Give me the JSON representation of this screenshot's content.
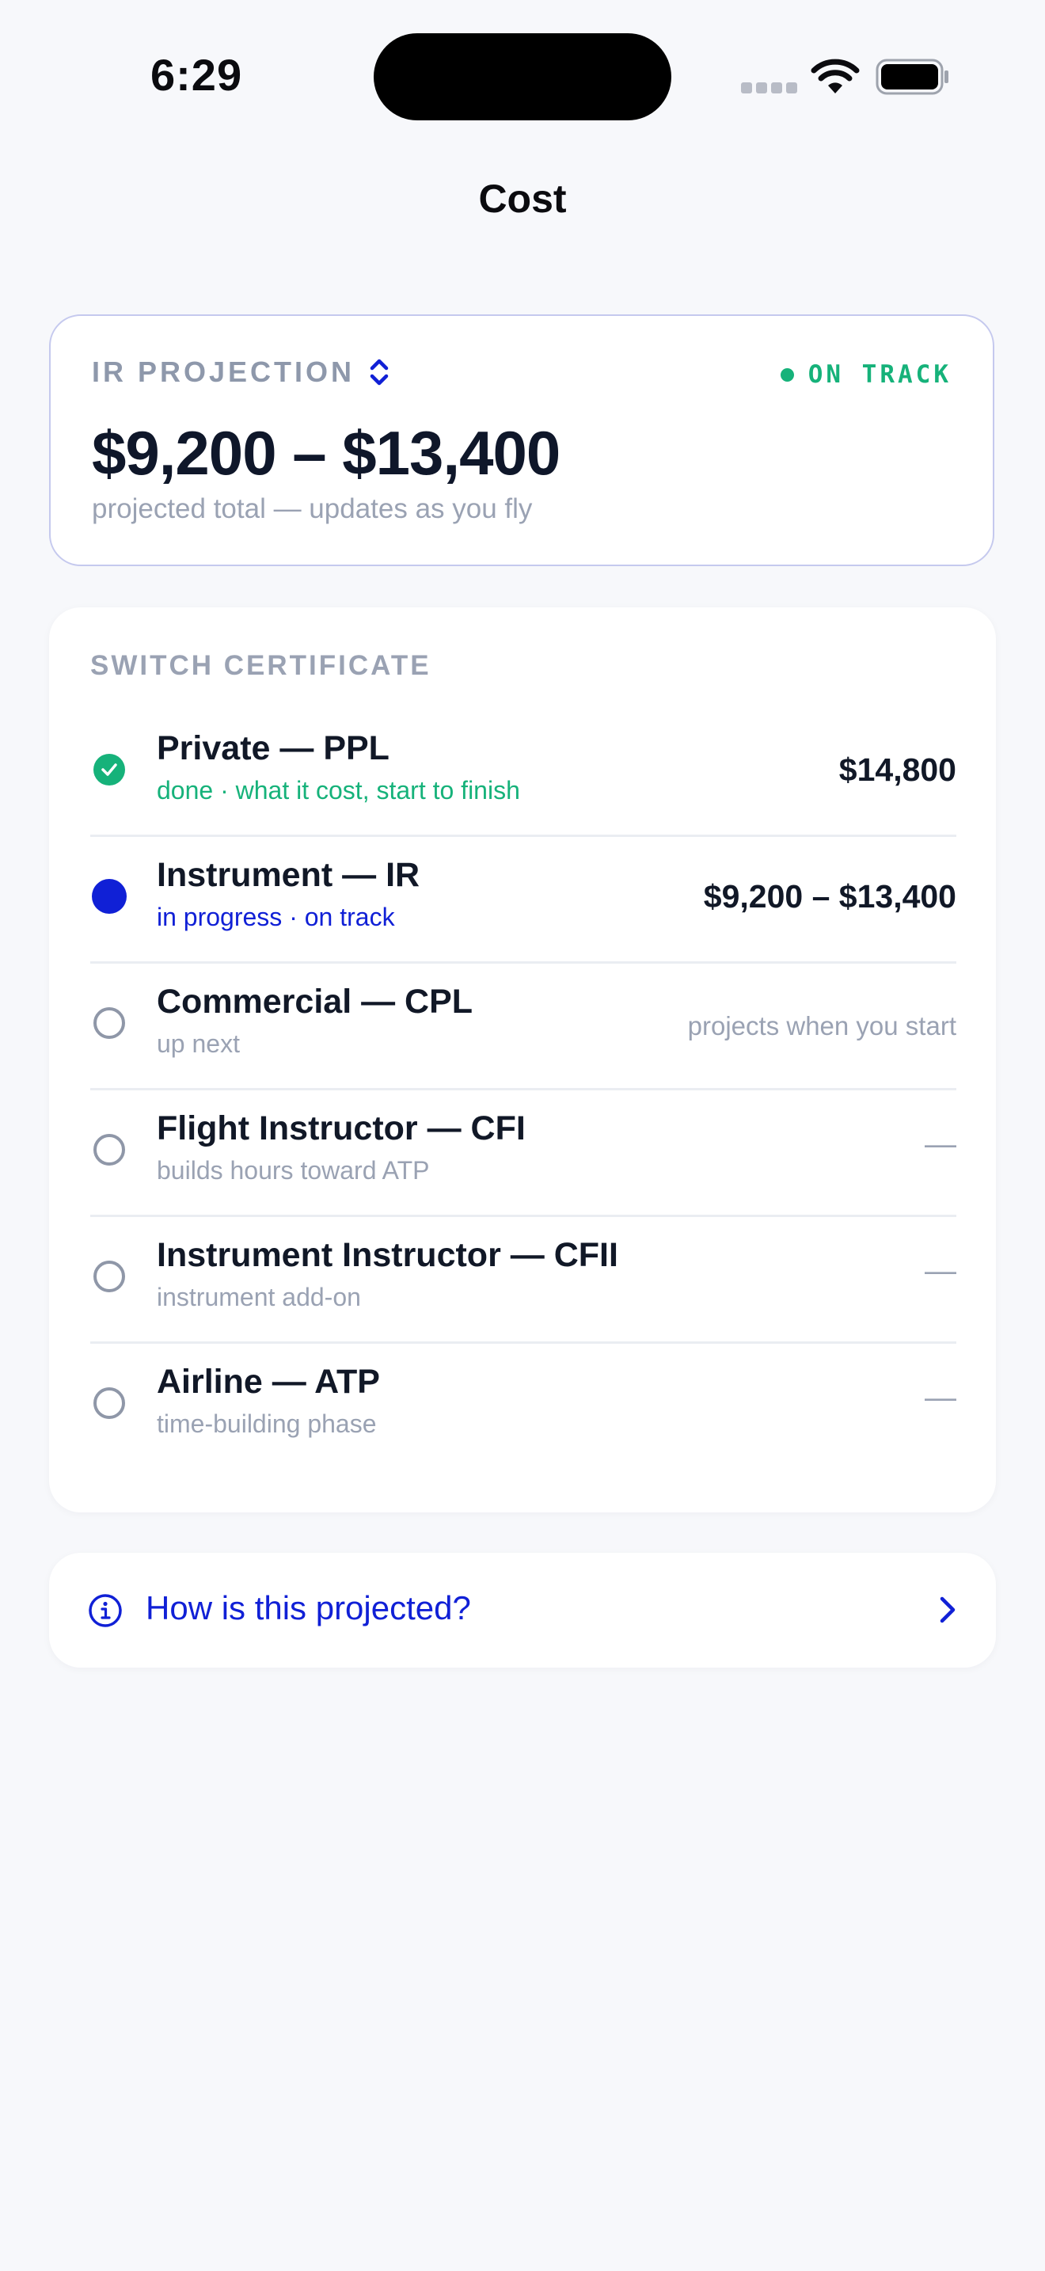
{
  "status_bar": {
    "time": "6:29"
  },
  "nav": {
    "title": "Cost"
  },
  "projection": {
    "label": "IR PROJECTION",
    "status": "ON TRACK",
    "amount": "$9,200 – $13,400",
    "subtitle": "projected total — updates as you fly"
  },
  "certificates": {
    "heading": "SWITCH CERTIFICATE",
    "items": [
      {
        "name": "Private — PPL",
        "subtitle": "done · what it cost, start to finish",
        "value": "$14,800",
        "state": "done"
      },
      {
        "name": "Instrument — IR",
        "subtitle": "in progress · on track",
        "value": "$9,200 – $13,400",
        "state": "in-progress"
      },
      {
        "name": "Commercial — CPL",
        "subtitle": "up next",
        "value": "projects when you start",
        "state": "pending"
      },
      {
        "name": "Flight Instructor — CFI",
        "subtitle": "builds hours toward ATP",
        "value": "—",
        "state": "pending"
      },
      {
        "name": "Instrument Instructor — CFII",
        "subtitle": "instrument add-on",
        "value": "—",
        "state": "pending"
      },
      {
        "name": "Airline — ATP",
        "subtitle": "time-building phase",
        "value": "—",
        "state": "pending"
      }
    ]
  },
  "info": {
    "label": "How is this projected?"
  },
  "colors": {
    "accent": "#1020d6",
    "success": "#16b27a",
    "muted": "#9aa2b3",
    "background": "#f7f8fb"
  },
  "icons": {
    "projection_picker": "chevron-up-down-icon",
    "done": "check-circle-icon",
    "info": "info-circle-icon",
    "disclosure": "chevron-right-icon"
  }
}
